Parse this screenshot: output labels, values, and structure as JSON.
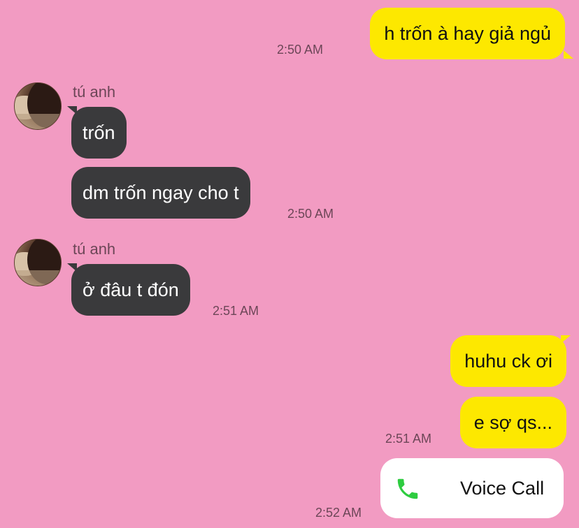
{
  "contact": {
    "name": "tú anh",
    "avatar_icon": "contact-avatar-photo"
  },
  "colors": {
    "background": "#f29bc2",
    "outgoing_bubble": "#fde800",
    "incoming_bubble": "#3a3a3c",
    "call_icon": "#2ecc40"
  },
  "messages": [
    {
      "direction": "out",
      "text": "h trốn à hay giả ngủ",
      "time": "2:50 AM"
    },
    {
      "direction": "in",
      "sender": "tú anh",
      "text": "trốn"
    },
    {
      "direction": "in",
      "text": "dm trốn ngay cho t",
      "time": "2:50 AM"
    },
    {
      "direction": "in",
      "sender": "tú anh",
      "text": "ở đâu t đón",
      "time": "2:51 AM"
    },
    {
      "direction": "out",
      "text": "huhu ck ơi"
    },
    {
      "direction": "out",
      "text": "e sợ qs...",
      "time": "2:51 AM"
    },
    {
      "direction": "out",
      "type": "call",
      "icon": "phone-icon",
      "text": "Voice Call",
      "time": "2:52 AM"
    }
  ]
}
